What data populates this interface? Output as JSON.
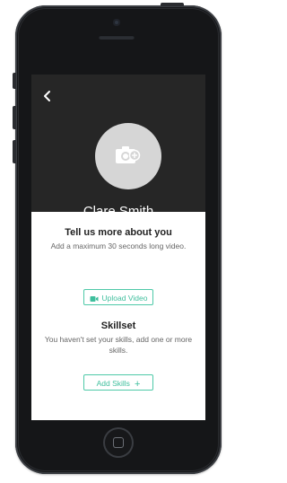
{
  "profile": {
    "name": "Clare Smith",
    "avatar_icon": "camera-icon"
  },
  "navigation": {
    "back_icon": "chevron-left-icon",
    "back_glyph": "‹"
  },
  "about_section": {
    "title": "Tell us more about you",
    "subtitle": "Add a maximum 30 seconds long video.",
    "upload_label": "Upload Video",
    "upload_icon": "video-camera-icon"
  },
  "skills_section": {
    "title": "Skillset",
    "subtitle": "You haven't set your skills, add one or more skills.",
    "add_label": "Add Skills",
    "add_glyph": "+"
  },
  "colors": {
    "header_bg": "#262626",
    "accent": "#4ec9a8",
    "phone_body": "#151618"
  }
}
